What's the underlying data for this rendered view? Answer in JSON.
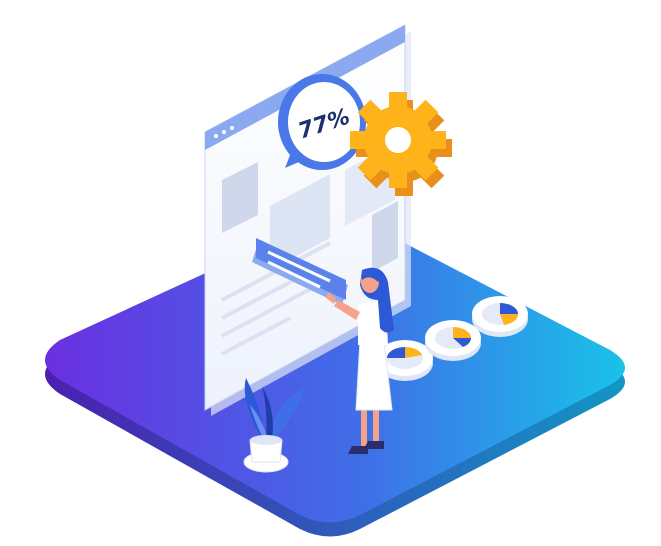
{
  "illustration": {
    "badge": {
      "text": "77%",
      "value": 77
    },
    "colors": {
      "platform_start": "#6a2fe0",
      "platform_end": "#19c2e8",
      "gear": "#ffb31a",
      "gear_shadow": "#e8901a",
      "badge_ring": "#4a78e8",
      "badge_text": "#1f2f6e",
      "window_bar": "#8ba9f0",
      "plant": "#2d59d6"
    },
    "icons": [
      "gear-icon",
      "percentage-badge",
      "pie-chart-icon",
      "plant-icon"
    ],
    "pie_disks": [
      {
        "filled_fraction": 0.3
      },
      {
        "filled_fraction": 0.25
      },
      {
        "filled_fraction": 0.35
      }
    ]
  }
}
